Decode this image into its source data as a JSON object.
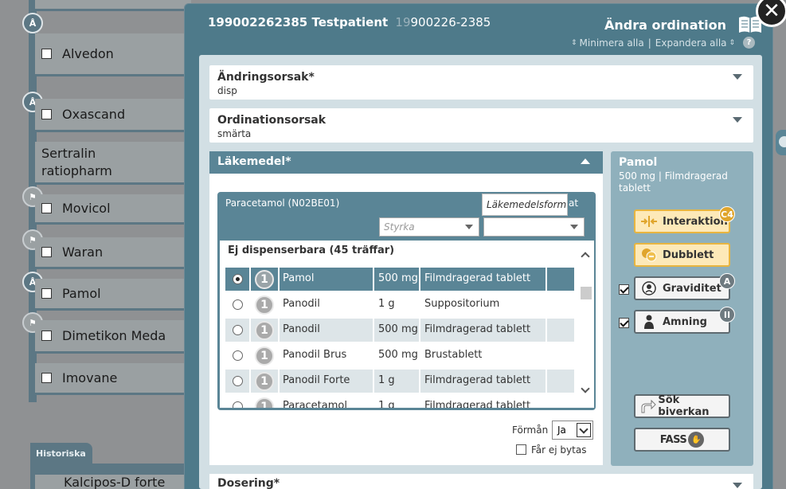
{
  "background_list": {
    "items": [
      {
        "name": "Alvedon",
        "badge": "Å"
      },
      {
        "name": "Oxascand",
        "badge": "Å"
      },
      {
        "name": "Sertralin ratiopharm",
        "badge": ""
      },
      {
        "name": "Movicol",
        "badge": "flag"
      },
      {
        "name": "Waran",
        "badge": "flag"
      },
      {
        "name": "Pamol",
        "badge": "Å"
      },
      {
        "name": "Dimetikon Meda",
        "badge": "flag"
      },
      {
        "name": "Imovane",
        "badge": ""
      }
    ],
    "historiska_tab": "Historiska",
    "historiska_first": "Kalcipos-D forte"
  },
  "modal": {
    "patient_name": "199002262385 Testpatient",
    "patient_pnr_dim": "19",
    "patient_pnr": "900226-2385",
    "title": "Ändra ordination",
    "minimize_all": "Minimera alla",
    "expand_all": "Expandera alla",
    "separator": "|",
    "help": "?"
  },
  "sections": {
    "andringsorsak": {
      "label": "Ändringsorsak*",
      "value": "disp"
    },
    "ordinationsorsak": {
      "label": "Ordinationsorsak",
      "value": "smärta"
    },
    "lakemedel": {
      "label": "Läkemedel*"
    },
    "dosering": {
      "label": "Dosering*"
    }
  },
  "search": {
    "title": "Paracetamol (N02BE01)",
    "tooltip": "Läkemedelsform",
    "hidden_suffix": "at",
    "strength_placeholder": "Styrka",
    "form_value": "",
    "results_title": "Ej dispenserbara (45 träffar)",
    "rows": [
      {
        "name": "Pamol",
        "strength": "500 mg",
        "form": "Filmdragerad tablett",
        "num": "1",
        "selected": true
      },
      {
        "name": "Panodil",
        "strength": "1 g",
        "form": "Suppositorium",
        "num": "1",
        "selected": false
      },
      {
        "name": "Panodil",
        "strength": "500 mg",
        "form": "Filmdragerad tablett",
        "num": "1",
        "selected": false
      },
      {
        "name": "Panodil Brus",
        "strength": "500 mg",
        "form": "Brustablett",
        "num": "1",
        "selected": false
      },
      {
        "name": "Panodil Forte",
        "strength": "1 g",
        "form": "Filmdragerad tablett",
        "num": "1",
        "selected": false
      },
      {
        "name": "Paracetamol",
        "strength": "1 g",
        "form": "Filmdragerad tablett",
        "num": "1",
        "selected": false
      }
    ]
  },
  "forman": {
    "label": "Förmån",
    "value": "Ja"
  },
  "byte": {
    "label": "Får ej bytas"
  },
  "side": {
    "name": "Pamol",
    "desc": "500 mg | Filmdragerad tablett",
    "interaktion": {
      "label": "Interaktion",
      "badge": "C4"
    },
    "dubblett": {
      "label": "Dubblett"
    },
    "graviditet": {
      "label": "Graviditet",
      "badge": "A"
    },
    "amning": {
      "label": "Amning",
      "badge": "II"
    },
    "sok_biverkan": {
      "label": "Sök biverkan"
    },
    "fass": {
      "label": "FASS"
    }
  },
  "colors": {
    "header": "#4e7a8a",
    "accent": "#5a8596",
    "warning": "#e8b540"
  }
}
